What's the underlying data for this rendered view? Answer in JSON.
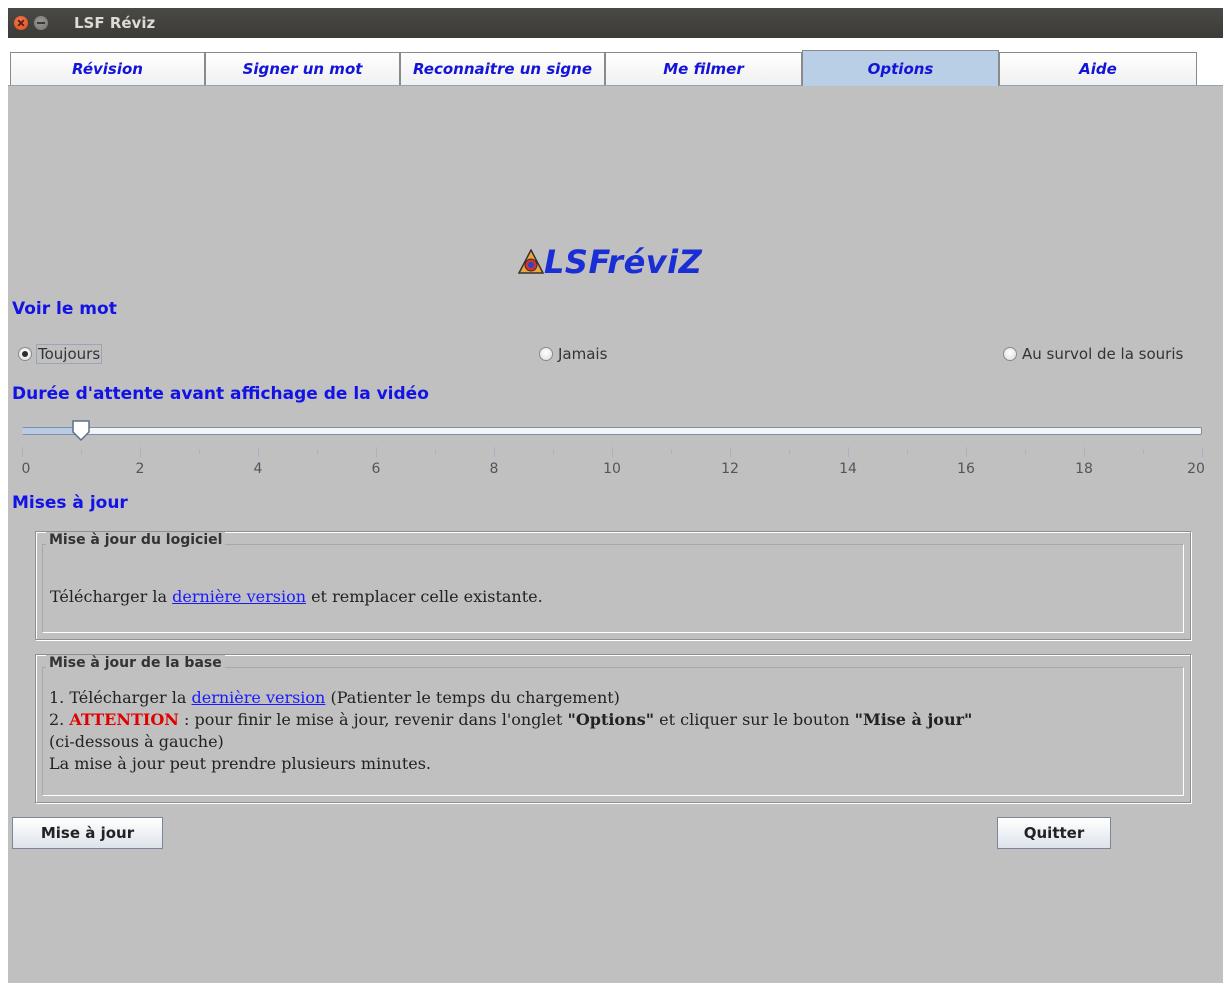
{
  "window": {
    "title": "LSF Réviz"
  },
  "tabs": [
    {
      "label": "Révision"
    },
    {
      "label": "Signer un mot"
    },
    {
      "label": "Reconnaitre un signe"
    },
    {
      "label": "Me filmer"
    },
    {
      "label": "Options",
      "active": true
    },
    {
      "label": "Aide"
    }
  ],
  "logo": {
    "text": "LSFréviZ"
  },
  "voir_le_mot": {
    "title": "Voir le mot",
    "options": [
      {
        "label": "Toujours",
        "checked": true
      },
      {
        "label": "Jamais",
        "checked": false
      },
      {
        "label": "Au survol de la souris",
        "checked": false
      }
    ]
  },
  "delay": {
    "title": "Durée d'attente avant affichage de la vidéo",
    "slider": {
      "min": 0,
      "max": 20,
      "value": 1
    },
    "tick_labels": [
      "0",
      "2",
      "4",
      "6",
      "8",
      "10",
      "12",
      "14",
      "16",
      "18",
      "20"
    ]
  },
  "updates": {
    "title": "Mises à jour",
    "software": {
      "title": "Mise à jour du logiciel",
      "text_before": "Télécharger la ",
      "link": "dernière version",
      "text_after": " et remplacer celle existante."
    },
    "database": {
      "title": "Mise à jour de la base",
      "line1_before": "1. Télécharger la ",
      "line1_link": "dernière version",
      "line1_after": " (Patienter le temps du chargement)",
      "line2_prefix": "2. ",
      "line2_warn": "ATTENTION",
      "line2_mid": " : pour finir le mise à jour, revenir dans l'onglet ",
      "line2_tab": "\"Options\"",
      "line2_mid2": " et cliquer sur le bouton ",
      "line2_button": "\"Mise à jour\"",
      "line3": "(ci-dessous à gauche)",
      "line4": "La mise à jour peut prendre plusieurs minutes."
    }
  },
  "buttons": {
    "update": "Mise à jour",
    "quit": "Quitter"
  },
  "colors": {
    "accent": "#1212e6",
    "background": "#c0c0c0",
    "active_tab": "#b8cfe5",
    "warning": "#e00000"
  }
}
